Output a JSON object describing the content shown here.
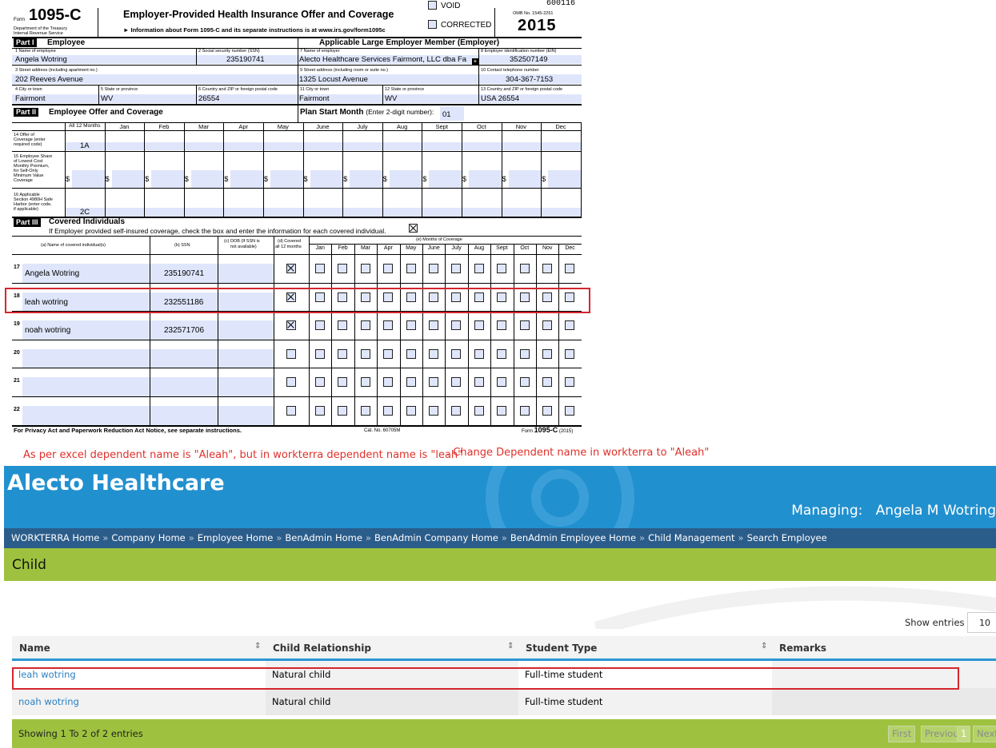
{
  "form": {
    "form_label": "Form",
    "form_number": "1095-C",
    "dept": [
      "Department of the Treasury",
      "Internal Revenue Service"
    ],
    "title": "Employer-Provided Health Insurance Offer and Coverage",
    "info": "Information about Form 1095-C and its separate instructions is at www.irs.gov/form1095c",
    "void_label": "VOID",
    "corrected_label": "CORRECTED",
    "serial": "600116",
    "omb": "OMB No. 1545-2251",
    "year": "2015",
    "part1_label": "Part I",
    "part1_title": "Employee",
    "ale_title": "Applicable Large Employer Member (Employer)",
    "fields": {
      "f1_label": "1 Name of employee",
      "f1": "Angela Wotring",
      "f2_label": "2 Social security number (SSN)",
      "f2": "235190741",
      "f3_label": "3 Street address (including apartment no.)",
      "f3": "202 Reeves Avenue",
      "f4_label": "4 City or town",
      "f4": "Fairmont",
      "f5_label": "5 State or province",
      "f5": "WV",
      "f6_label": "6 Country and ZIP or foreign postal code",
      "f6": "26554",
      "f7_label": "7 Name of employer",
      "f7": "Alecto Healthcare Services Fairmont, LLC dba Fa",
      "f8_label": "8 Employer identification number (EIN)",
      "f8": "352507149",
      "f9_label": "9 Street address (including room or suite no.)",
      "f9": "1325 Locust Avenue",
      "f10_label": "10 Contact telephone number",
      "f10": "304-367-7153",
      "f11_label": "11 City or town",
      "f11": "Fairmont",
      "f12_label": "12 State or province",
      "f12": "WV",
      "f13_label": "13 Country and ZIP or foreign postal code",
      "f13": "USA 26554"
    },
    "part2_label": "Part II",
    "part2_title": "Employee Offer and Coverage",
    "plan_start_label": "Plan Start Month",
    "plan_start_hint": "(Enter 2-digit number):",
    "plan_start_value": "01",
    "months_all": "All 12 Months",
    "months": [
      "Jan",
      "Feb",
      "Mar",
      "Apr",
      "May",
      "June",
      "July",
      "Aug",
      "Sept",
      "Oct",
      "Nov",
      "Dec"
    ],
    "line14_label": [
      "14 Offer of",
      "Coverage (enter",
      "required code)"
    ],
    "line14_all": "1A",
    "line15_label": [
      "15 Employee Share",
      "of Lowest Cost",
      "Monthly Premium,",
      "for Self-Only",
      "Minimum Value",
      "Coverage"
    ],
    "dollar": "$",
    "line16_label": [
      "16 Applicable",
      "Section 4980H Safe",
      "Harbor (enter code,",
      "if applicable)"
    ],
    "line16_all": "2C",
    "part3_label": "Part III",
    "part3_title": "Covered Individuals",
    "part3_instr": "If Employer provided self-insured coverage, check the box and enter the information for each covered individual.",
    "col_a": "(a) Name of covered individual(s)",
    "col_b": "(b) SSN",
    "col_c": [
      "(c) DOB (If SSN is",
      "not available)"
    ],
    "col_d": [
      "(d) Covered",
      "all 12 months"
    ],
    "col_e": "(e) Months of Coverage",
    "months_short": [
      "Jan",
      "Feb",
      "Mar",
      "Apr",
      "May",
      "June",
      "July",
      "Aug",
      "Sept",
      "Oct",
      "Nov",
      "Dec"
    ],
    "covered": [
      {
        "line": "17",
        "name": "Angela Wotring",
        "ssn": "235190741",
        "all12": true
      },
      {
        "line": "18",
        "name": "leah wotring",
        "ssn": "232551186",
        "all12": true
      },
      {
        "line": "19",
        "name": "noah wotring",
        "ssn": "232571706",
        "all12": true
      },
      {
        "line": "20",
        "name": "",
        "ssn": "",
        "all12": false
      },
      {
        "line": "21",
        "name": "",
        "ssn": "",
        "all12": false
      },
      {
        "line": "22",
        "name": "",
        "ssn": "",
        "all12": false
      }
    ],
    "footer_left": "For Privacy Act and Paperwork Reduction Act Notice, see separate instructions.",
    "footer_cat": "Cat. No. 60705M",
    "footer_right_form": "Form",
    "footer_right_num": "1095-C",
    "footer_right_year": "(2015)"
  },
  "annotation": {
    "note1": "As per excel dependent name is \"Aleah\", but in workterra dependent name is \"leah\"",
    "note2": ". Change Dependent name in workterra to \"Aleah\"",
    "color": "#e0302a"
  },
  "workterra": {
    "brand": "Alecto Healthcare",
    "managing_label": "Managing:",
    "managing_name": "Angela M Wotring",
    "breadcrumbs": [
      "WORKTERRA Home",
      "Company Home",
      "Employee Home",
      "BenAdmin Home",
      "BenAdmin Company Home",
      "BenAdmin Employee Home",
      "Child Management",
      "Search Employee"
    ],
    "breadcrumb_sep": "»",
    "page_title": "Child",
    "show_entries_label": "Show entries",
    "show_entries_value": "10",
    "columns": [
      "Name",
      "Child Relationship",
      "Student Type",
      "Remarks"
    ],
    "sort_icon": "⇕",
    "rows": [
      {
        "name": "leah wotring",
        "relationship": "Natural child",
        "student_type": "Full-time student",
        "remarks": ""
      },
      {
        "name": "noah wotring",
        "relationship": "Natural child",
        "student_type": "Full-time student",
        "remarks": ""
      }
    ],
    "showing": "Showing 1 To 2 of 2 entries",
    "pager": {
      "first": "First",
      "previous": "Previous",
      "current": "1",
      "next": "Next"
    },
    "colors": {
      "banner": "#2190cf",
      "breadcrumb_bar": "#2b5d8b",
      "green": "#9ec23f",
      "link": "#2b7fc0"
    }
  }
}
